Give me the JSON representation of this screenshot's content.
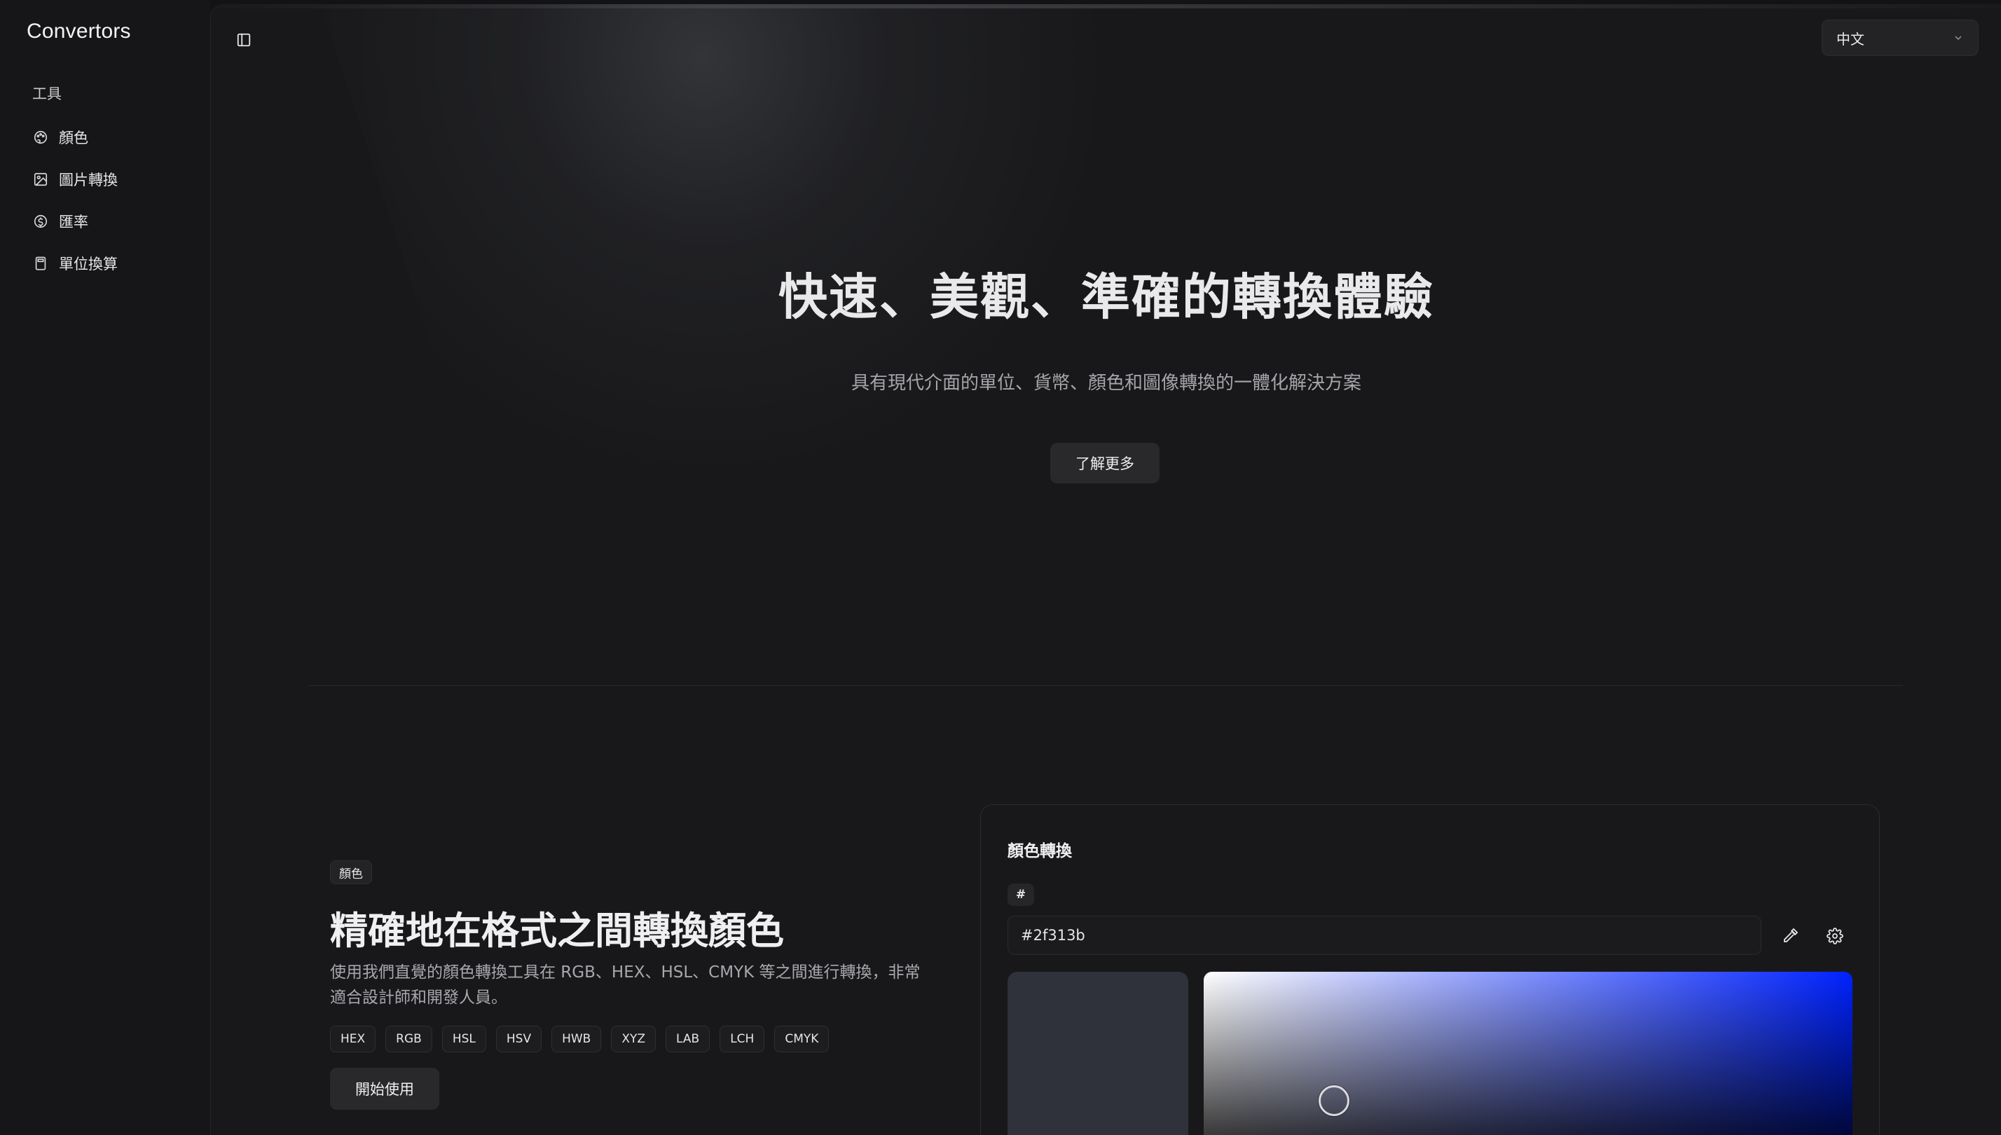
{
  "app": {
    "brand": "Convertors"
  },
  "sidebar": {
    "section_label": "工具",
    "items": [
      {
        "label": "顏色",
        "icon": "palette-icon"
      },
      {
        "label": "圖片轉換",
        "icon": "image-icon"
      },
      {
        "label": "匯率",
        "icon": "currency-icon"
      },
      {
        "label": "單位換算",
        "icon": "calculator-icon"
      }
    ]
  },
  "header": {
    "language": "中文"
  },
  "hero": {
    "title": "快速、美觀、準確的轉換體驗",
    "subtitle": "具有現代介面的單位、貨幣、顏色和圖像轉換的一體化解決方案",
    "cta": "了解更多"
  },
  "feature": {
    "badge": "顏色",
    "title": "精確地在格式之間轉換顏色",
    "description": "使用我們直覺的顏色轉換工具在 RGB、HEX、HSL、CMYK 等之間進行轉換，非常適合設計師和開發人員。",
    "formats": [
      "HEX",
      "RGB",
      "HSL",
      "HSV",
      "HWB",
      "XYZ",
      "LAB",
      "LCH",
      "CMYK"
    ],
    "cta": "開始使用"
  },
  "color_card": {
    "title": "顏色轉換",
    "prefix": "#",
    "hex_value": "#2f313b",
    "swatch_color": "#2f313b",
    "picker_hue_color": "#0022ff"
  },
  "colors": {
    "background": "#131315",
    "panel": "#18181a",
    "button": "#29292c",
    "text_primary": "#f2f2f3",
    "text_muted": "#a5a5ab"
  }
}
